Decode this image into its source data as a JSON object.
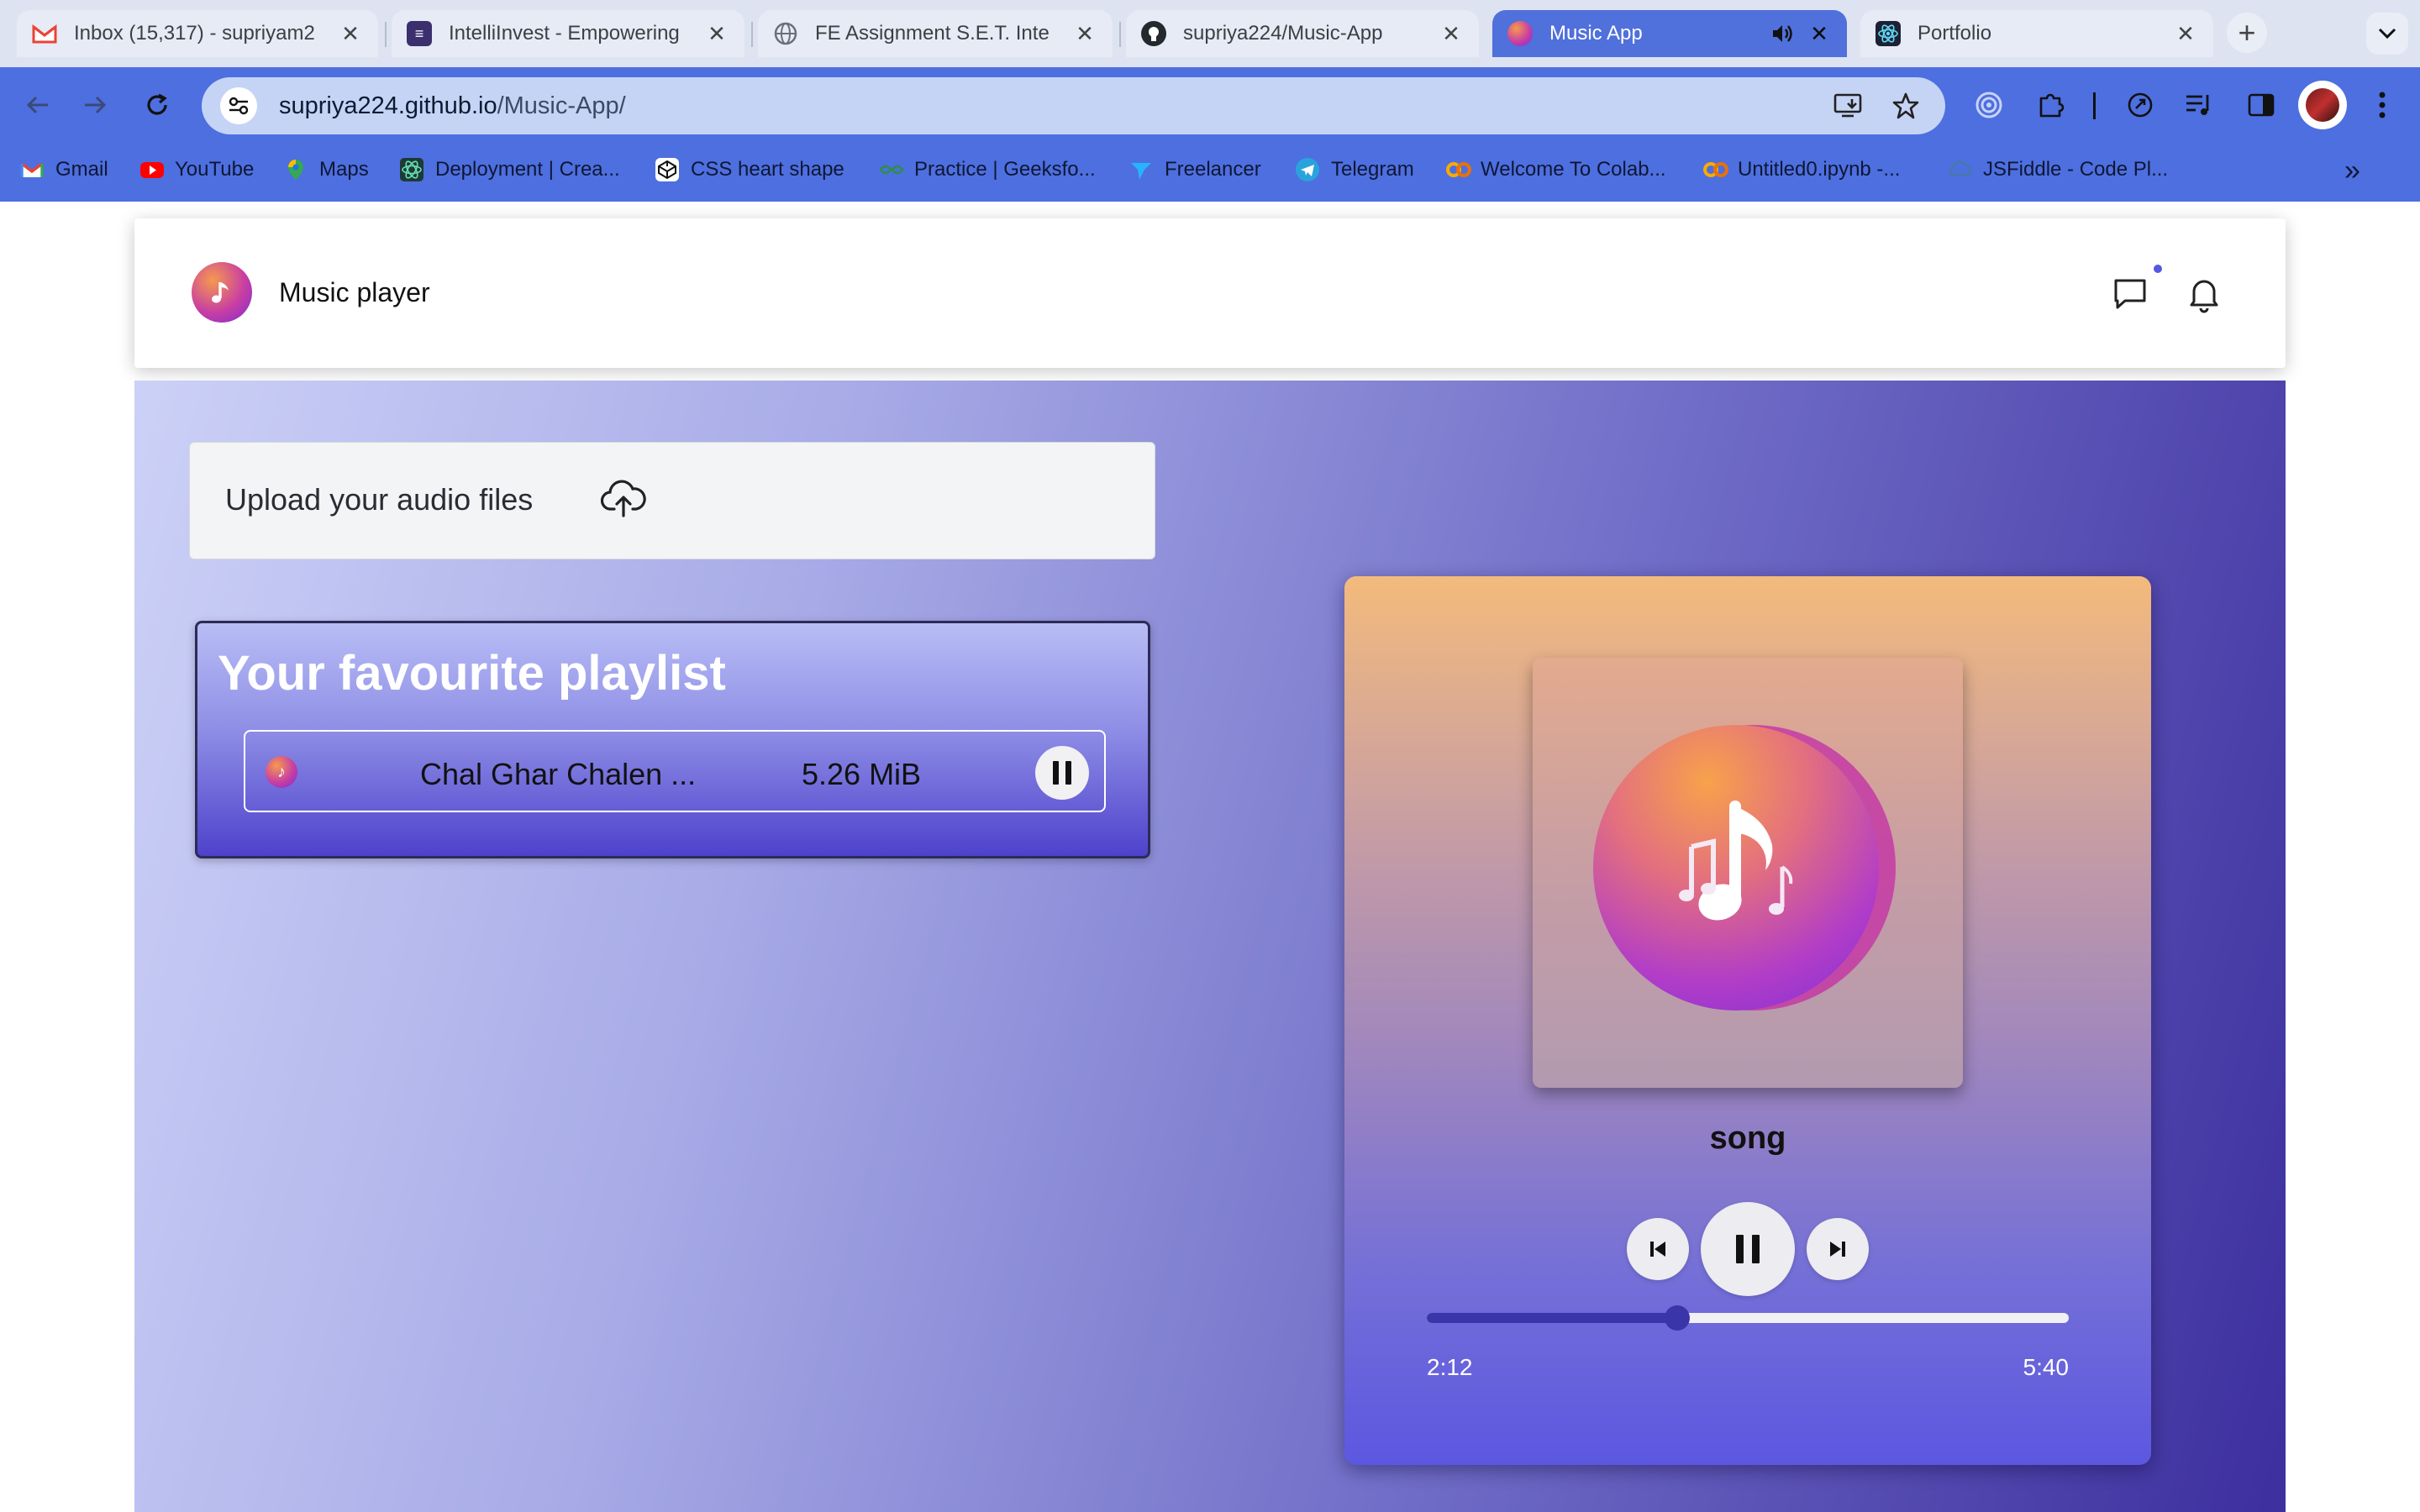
{
  "browser": {
    "tabs": [
      {
        "title": "Inbox (15,317) - supriyam2",
        "favicon": "gmail-icon",
        "active": false
      },
      {
        "title": "IntelliInvest - Empowering",
        "favicon": "intelliinvest-icon",
        "active": false
      },
      {
        "title": "FE Assignment S.E.T. Inte",
        "favicon": "globe-icon",
        "active": false
      },
      {
        "title": "supriya224/Music-App",
        "favicon": "github-icon",
        "active": false
      },
      {
        "title": "Music App",
        "favicon": "music-app-icon",
        "active": true,
        "audio": true
      },
      {
        "title": "Portfolio",
        "favicon": "react-icon",
        "active": false
      }
    ],
    "url_host": "supriya224.github.io",
    "url_path": "/Music-App/",
    "bookmarks": [
      {
        "label": "Gmail",
        "icon": "gmail-icon",
        "color": "#ea4335"
      },
      {
        "label": "YouTube",
        "icon": "youtube-icon",
        "color": "#ff0000"
      },
      {
        "label": "Maps",
        "icon": "maps-icon",
        "color": "#34a853"
      },
      {
        "label": "Deployment | Crea...",
        "icon": "react-icon",
        "color": "#1e3a34"
      },
      {
        "label": "CSS heart shape",
        "icon": "codepen-icon",
        "color": "#ffffff"
      },
      {
        "label": "Practice | Geeksfo...",
        "icon": "gfg-icon",
        "color": "#2f8d46"
      },
      {
        "label": "Freelancer",
        "icon": "freelancer-icon",
        "color": "#29b2fe"
      },
      {
        "label": "Telegram",
        "icon": "telegram-icon",
        "color": "#2aa3dd"
      },
      {
        "label": "Welcome To Colab...",
        "icon": "colab-icon",
        "color": "#f9ab00"
      },
      {
        "label": "Untitled0.ipynb -...",
        "icon": "colab-icon",
        "color": "#f9ab00"
      },
      {
        "label": "JSFiddle - Code Pl...",
        "icon": "jsfiddle-icon",
        "color": "#4679a4"
      }
    ]
  },
  "app": {
    "brand": "Music player",
    "upload_label": "Upload your audio files",
    "playlist_title": "Your favourite playlist",
    "tracks": [
      {
        "name": "Chal Ghar Chalen ...",
        "size": "5.26 MiB"
      }
    ],
    "player": {
      "song_title": "song",
      "current_time": "2:12",
      "total_time": "5:40",
      "progress": 0.39
    }
  },
  "colors": {
    "accent": "#3a35a8",
    "chrome_toolbar": "#4d6fe0",
    "notification_dot": "#5558e0"
  }
}
